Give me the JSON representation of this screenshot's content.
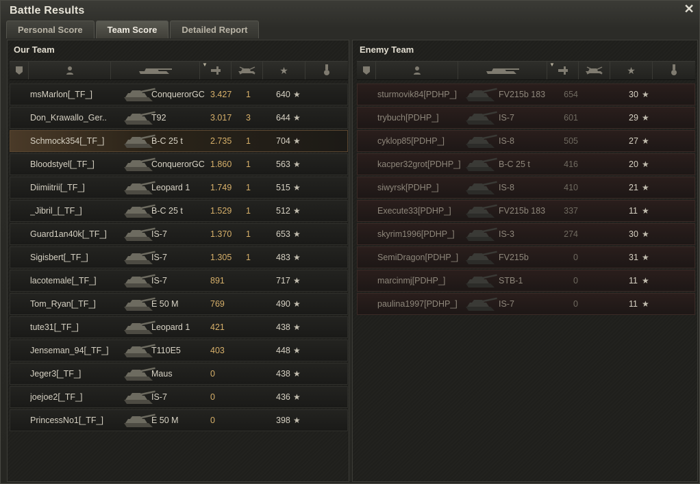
{
  "window": {
    "title": "Battle Results",
    "close_glyph": "✕"
  },
  "tabs": [
    {
      "label": "Personal Score",
      "active": false
    },
    {
      "label": "Team Score",
      "active": true
    },
    {
      "label": "Detailed Report",
      "active": false
    }
  ],
  "our_team": {
    "title": "Our Team",
    "rows": [
      {
        "player": "msMarlon[_TF_]",
        "tank": "ConquerorGC",
        "damage": "3.427",
        "kills": "1",
        "xp": "640"
      },
      {
        "player": "Don_Krawallo_Ger..",
        "tank": "T92",
        "damage": "3.017",
        "kills": "3",
        "xp": "644"
      },
      {
        "player": "Schmock354[_TF_]",
        "tank": "B-C 25 t",
        "damage": "2.735",
        "kills": "1",
        "xp": "704"
      },
      {
        "player": "Bloodstyel[_TF_]",
        "tank": "ConquerorGC",
        "damage": "1.860",
        "kills": "1",
        "xp": "563"
      },
      {
        "player": "Diimiitrii[_TF_]",
        "tank": "Leopard 1",
        "damage": "1.749",
        "kills": "1",
        "xp": "515"
      },
      {
        "player": "_Jibril_[_TF_]",
        "tank": "B-C 25 t",
        "damage": "1.529",
        "kills": "1",
        "xp": "512"
      },
      {
        "player": "Guard1an40k[_TF_]",
        "tank": "IS-7",
        "damage": "1.370",
        "kills": "1",
        "xp": "653"
      },
      {
        "player": "Sigisbert[_TF_]",
        "tank": "IS-7",
        "damage": "1.305",
        "kills": "1",
        "xp": "483"
      },
      {
        "player": "lacotemale[_TF_]",
        "tank": "IS-7",
        "damage": "891",
        "kills": "",
        "xp": "717"
      },
      {
        "player": "Tom_Ryan[_TF_]",
        "tank": "E 50 M",
        "damage": "769",
        "kills": "",
        "xp": "490"
      },
      {
        "player": "tute31[_TF_]",
        "tank": "Leopard 1",
        "damage": "421",
        "kills": "",
        "xp": "438"
      },
      {
        "player": "Jenseman_94[_TF_]",
        "tank": "T110E5",
        "damage": "403",
        "kills": "",
        "xp": "448"
      },
      {
        "player": "Jeger3[_TF_]",
        "tank": "Maus",
        "damage": "0",
        "kills": "",
        "xp": "438"
      },
      {
        "player": "joejoe2[_TF_]",
        "tank": "IS-7",
        "damage": "0",
        "kills": "",
        "xp": "436"
      },
      {
        "player": "PrincessNo1[_TF_]",
        "tank": "E 50 M",
        "damage": "0",
        "kills": "",
        "xp": "398"
      }
    ]
  },
  "enemy_team": {
    "title": "Enemy Team",
    "rows": [
      {
        "player": "sturmovik84[PDHP_]",
        "tank": "FV215b 183",
        "damage": "654",
        "xp": "30"
      },
      {
        "player": "trybuch[PDHP_]",
        "tank": "IS-7",
        "damage": "601",
        "xp": "29"
      },
      {
        "player": "cyklop85[PDHP_]",
        "tank": "IS-8",
        "damage": "505",
        "xp": "27"
      },
      {
        "player": "kacper32grot[PDHP_]",
        "tank": "B-C 25 t",
        "damage": "416",
        "xp": "20"
      },
      {
        "player": "siwyrsk[PDHP_]",
        "tank": "IS-8",
        "damage": "410",
        "xp": "21"
      },
      {
        "player": "Execute33[PDHP_]",
        "tank": "FV215b 183",
        "damage": "337",
        "xp": "11"
      },
      {
        "player": "skyrim1996[PDHP_]",
        "tank": "IS-3",
        "damage": "274",
        "xp": "30"
      },
      {
        "player": "SemiDragon[PDHP_]",
        "tank": "FV215b",
        "damage": "0",
        "xp": "31"
      },
      {
        "player": "marcinmj[PDHP_]",
        "tank": "STB-1",
        "damage": "0",
        "xp": "11"
      },
      {
        "player": "paulina1997[PDHP_]",
        "tank": "IS-7",
        "damage": "0",
        "xp": "11"
      }
    ]
  },
  "icons": {
    "columns": [
      "platoon-icon",
      "player-icon",
      "tank-icon",
      "damage-icon",
      "kills-icon",
      "xp-icon",
      "medal-icon"
    ],
    "xp_star": "★"
  },
  "colors": {
    "damage_highlight": "#d7b06a",
    "selected_row": "#4a3a28",
    "enemy_row": "#2a1e1c"
  }
}
